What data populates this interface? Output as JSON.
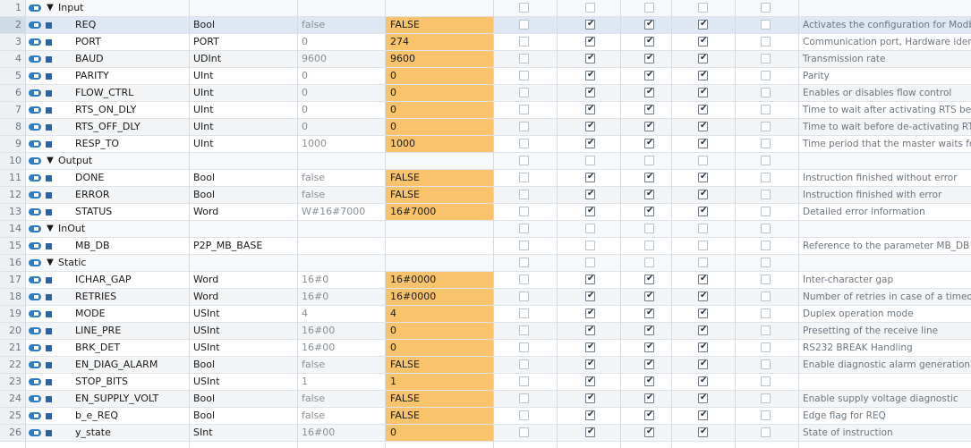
{
  "table": {
    "rows": [
      {
        "num": "1",
        "kind": "section",
        "name": "Input"
      },
      {
        "num": "2",
        "kind": "param",
        "name": "REQ",
        "type": "Bool",
        "default": "false",
        "monitor": "FALSE",
        "checks": [
          false,
          true,
          true,
          true,
          false
        ],
        "comment": "Activates the configuration for Modbus"
      },
      {
        "num": "3",
        "kind": "param",
        "name": "PORT",
        "type": "PORT",
        "default": "0",
        "monitor": "274",
        "checks": [
          false,
          true,
          true,
          true,
          false
        ],
        "comment": "Communication port, Hardware identifier"
      },
      {
        "num": "4",
        "kind": "param",
        "name": "BAUD",
        "type": "UDInt",
        "default": "9600",
        "monitor": "9600",
        "checks": [
          false,
          true,
          true,
          true,
          false
        ],
        "comment": "Transmission rate"
      },
      {
        "num": "5",
        "kind": "param",
        "name": "PARITY",
        "type": "UInt",
        "default": "0",
        "monitor": "0",
        "checks": [
          false,
          true,
          true,
          true,
          false
        ],
        "comment": "Parity"
      },
      {
        "num": "6",
        "kind": "param",
        "name": "FLOW_CTRL",
        "type": "UInt",
        "default": "0",
        "monitor": "0",
        "checks": [
          false,
          true,
          true,
          true,
          false
        ],
        "comment": "Enables or disables flow control"
      },
      {
        "num": "7",
        "kind": "param",
        "name": "RTS_ON_DLY",
        "type": "UInt",
        "default": "0",
        "monitor": "0",
        "checks": [
          false,
          true,
          true,
          true,
          false
        ],
        "comment": "Time to wait after activating RTS before"
      },
      {
        "num": "8",
        "kind": "param",
        "name": "RTS_OFF_DLY",
        "type": "UInt",
        "default": "0",
        "monitor": "0",
        "checks": [
          false,
          true,
          true,
          true,
          false
        ],
        "comment": "Time to wait before de-activating RTS"
      },
      {
        "num": "9",
        "kind": "param",
        "name": "RESP_TO",
        "type": "UInt",
        "default": "1000",
        "monitor": "1000",
        "checks": [
          false,
          true,
          true,
          true,
          false
        ],
        "comment": "Time period that the master waits for"
      },
      {
        "num": "10",
        "kind": "section",
        "name": "Output"
      },
      {
        "num": "11",
        "kind": "param",
        "name": "DONE",
        "type": "Bool",
        "default": "false",
        "monitor": "FALSE",
        "checks": [
          false,
          true,
          true,
          true,
          false
        ],
        "comment": "Instruction finished without error"
      },
      {
        "num": "12",
        "kind": "param",
        "name": "ERROR",
        "type": "Bool",
        "default": "false",
        "monitor": "FALSE",
        "checks": [
          false,
          true,
          true,
          true,
          false
        ],
        "comment": "Instruction finished with error"
      },
      {
        "num": "13",
        "kind": "param",
        "name": "STATUS",
        "type": "Word",
        "default": "W#16#7000",
        "monitor": "16#7000",
        "checks": [
          false,
          true,
          true,
          true,
          false
        ],
        "comment": "Detailed error information"
      },
      {
        "num": "14",
        "kind": "section",
        "name": "InOut"
      },
      {
        "num": "15",
        "kind": "param",
        "name": "MB_DB",
        "type": "P2P_MB_BASE",
        "default": "",
        "monitor": "",
        "checks": [
          false,
          false,
          false,
          false,
          false
        ],
        "comment": "Reference to the parameter MB_DB of"
      },
      {
        "num": "16",
        "kind": "section",
        "name": "Static"
      },
      {
        "num": "17",
        "kind": "param",
        "name": "ICHAR_GAP",
        "type": "Word",
        "default": "16#0",
        "monitor": "16#0000",
        "checks": [
          false,
          true,
          true,
          true,
          false
        ],
        "comment": "Inter-character gap"
      },
      {
        "num": "18",
        "kind": "param",
        "name": "RETRIES",
        "type": "Word",
        "default": "16#0",
        "monitor": "16#0000",
        "checks": [
          false,
          true,
          true,
          true,
          false
        ],
        "comment": "Number of retries in case of a timeout"
      },
      {
        "num": "19",
        "kind": "param",
        "name": "MODE",
        "type": "USInt",
        "default": "4",
        "monitor": "4",
        "checks": [
          false,
          true,
          true,
          true,
          false
        ],
        "comment": "Duplex operation mode"
      },
      {
        "num": "20",
        "kind": "param",
        "name": "LINE_PRE",
        "type": "USInt",
        "default": "16#00",
        "monitor": "0",
        "checks": [
          false,
          true,
          true,
          true,
          false
        ],
        "comment": "Presetting of the receive line"
      },
      {
        "num": "21",
        "kind": "param",
        "name": "BRK_DET",
        "type": "USInt",
        "default": "16#00",
        "monitor": "0",
        "checks": [
          false,
          true,
          true,
          true,
          false
        ],
        "comment": "RS232 BREAK Handling"
      },
      {
        "num": "22",
        "kind": "param",
        "name": "EN_DIAG_ALARM",
        "type": "Bool",
        "default": "false",
        "monitor": "FALSE",
        "checks": [
          false,
          true,
          true,
          true,
          false
        ],
        "comment": "Enable diagnostic alarm generation"
      },
      {
        "num": "23",
        "kind": "param",
        "name": "STOP_BITS",
        "type": "USInt",
        "default": "1",
        "monitor": "1",
        "checks": [
          false,
          true,
          true,
          true,
          false
        ],
        "comment": ""
      },
      {
        "num": "24",
        "kind": "param",
        "name": "EN_SUPPLY_VOLT",
        "type": "Bool",
        "default": "false",
        "monitor": "FALSE",
        "checks": [
          false,
          true,
          true,
          true,
          false
        ],
        "comment": "Enable supply voltage diagnostic"
      },
      {
        "num": "25",
        "kind": "param",
        "name": "b_e_REQ",
        "type": "Bool",
        "default": "false",
        "monitor": "FALSE",
        "checks": [
          false,
          true,
          true,
          true,
          false
        ],
        "comment": "Edge flag for REQ"
      },
      {
        "num": "26",
        "kind": "param",
        "name": "y_state",
        "type": "SInt",
        "default": "16#00",
        "monitor": "0",
        "checks": [
          false,
          true,
          true,
          true,
          false
        ],
        "comment": "State of instruction"
      }
    ]
  },
  "colors": {
    "monitor_bg": "#f8c36a",
    "icon_blue": "#2d7dc4",
    "selected_row": "#dfe8f2"
  },
  "icons": {
    "row_icon": "interface-pin-icon",
    "section_toggle": "collapse-triangle-icon",
    "param_marker": "parameter-square-icon",
    "checkbox": "checkbox-icon"
  }
}
